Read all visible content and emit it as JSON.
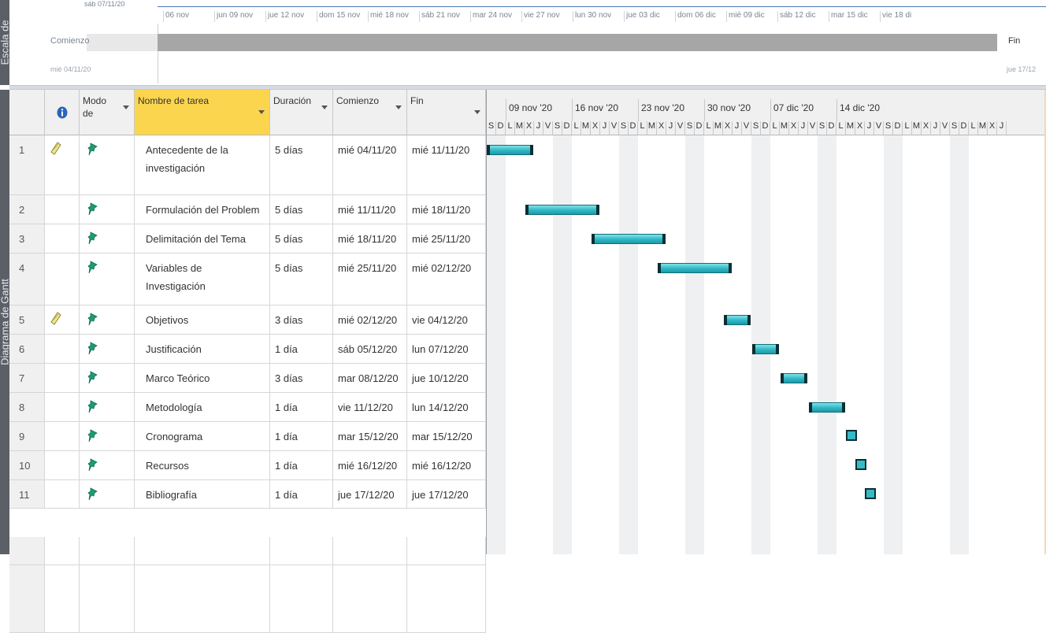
{
  "sidebar": {
    "timeline_label": "Escala de",
    "gantt_label": "Diagrama de Gantt"
  },
  "timeline": {
    "top_date": "sáb 07/11/20",
    "start_label": "Comienzo",
    "start_date": "mié 04/11/20",
    "end_label": "Fin",
    "end_date": "jue 17/12",
    "dates": [
      "06 nov",
      "jun 09 nov",
      "jue 12 nov",
      "dom 15 nov",
      "mié 18 nov",
      "sáb 21 nov",
      "mar 24 nov",
      "vie 27 nov",
      "lun 30 nov",
      "jue 03 dic",
      "dom 06 dic",
      "mié 09 dic",
      "sáb 12 dic",
      "mar 15 dic",
      "vie 18 di"
    ]
  },
  "table": {
    "headers": {
      "mode_line1": "Modo",
      "mode_line2": "de",
      "name": "Nombre de tarea",
      "duration": "Duración",
      "start": "Comienzo",
      "end": "Fin"
    },
    "rows": [
      {
        "id": "1",
        "note": true,
        "name": "Antecedente de la investigación",
        "duration": "5 días",
        "start": "mié 04/11/20",
        "end": "mié 11/11/20"
      },
      {
        "id": "2",
        "note": false,
        "name": "Formulación del Problem",
        "duration": "5 días",
        "start": "mié 11/11/20",
        "end": "mié 18/11/20"
      },
      {
        "id": "3",
        "note": false,
        "name": "Delimitación del Tema",
        "duration": "5 días",
        "start": "mié 18/11/20",
        "end": "mié 25/11/20"
      },
      {
        "id": "4",
        "note": false,
        "name": "Variables de Investigación",
        "duration": "5 días",
        "start": "mié 25/11/20",
        "end": "mié 02/12/20"
      },
      {
        "id": "5",
        "note": true,
        "name": "Objetivos",
        "duration": "3 días",
        "start": "mié 02/12/20",
        "end": "vie 04/12/20"
      },
      {
        "id": "6",
        "note": false,
        "name": "Justificación",
        "duration": "1 día",
        "start": "sáb 05/12/20",
        "end": "lun 07/12/20"
      },
      {
        "id": "7",
        "note": false,
        "name": "Marco Teórico",
        "duration": "3 días",
        "start": "mar 08/12/20",
        "end": "jue 10/12/20"
      },
      {
        "id": "8",
        "note": false,
        "name": "Metodología",
        "duration": "1 día",
        "start": "vie 11/12/20",
        "end": "lun 14/12/20"
      },
      {
        "id": "9",
        "note": false,
        "name": "Cronograma",
        "duration": "1 día",
        "start": "mar 15/12/20",
        "end": "mar 15/12/20"
      },
      {
        "id": "10",
        "note": false,
        "name": "Recursos",
        "duration": "1 día",
        "start": "mié 16/12/20",
        "end": "mié 16/12/20"
      },
      {
        "id": "11",
        "note": false,
        "name": "Bibliografía",
        "duration": "1 día",
        "start": "jue 17/12/20",
        "end": "jue 17/12/20"
      }
    ]
  },
  "chart": {
    "weeks": [
      "09 nov '20",
      "16 nov '20",
      "23 nov '20",
      "30 nov '20",
      "07 dic '20",
      "14 dic '20"
    ],
    "days": [
      "S",
      "D",
      "L",
      "M",
      "X",
      "J",
      "V",
      "S",
      "D",
      "L",
      "M",
      "X",
      "J",
      "V",
      "S",
      "D",
      "L",
      "M",
      "X",
      "J",
      "V",
      "S",
      "D",
      "L",
      "M",
      "X",
      "J",
      "V",
      "S",
      "D",
      "L",
      "M",
      "X",
      "J",
      "V",
      "S",
      "D",
      "L",
      "M",
      "X",
      "J",
      "V",
      "S",
      "D",
      "L",
      "M",
      "X",
      "J",
      "V",
      "S",
      "D",
      "L",
      "M",
      "X",
      "J"
    ],
    "bar_color": "#2fb6c4",
    "weekend_color": "#eef0f2"
  }
}
